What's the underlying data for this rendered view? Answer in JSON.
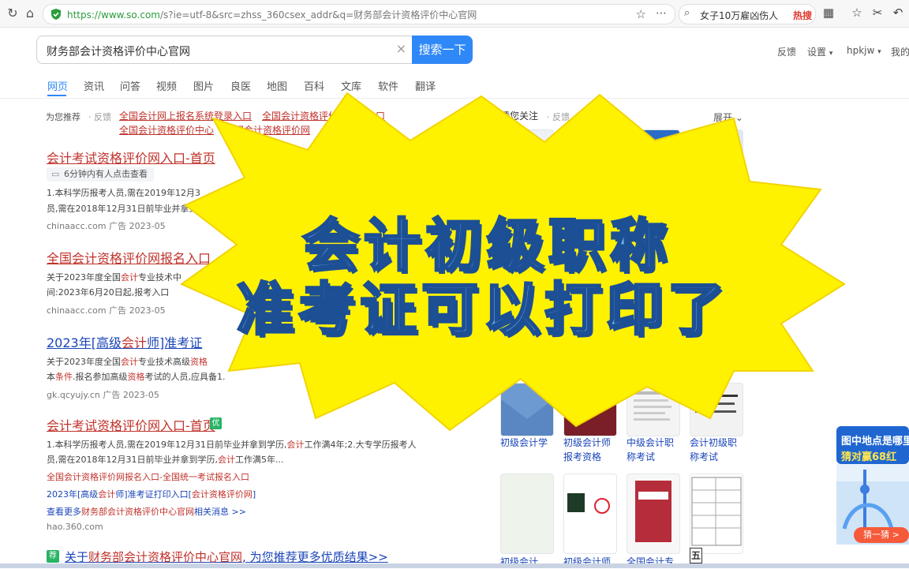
{
  "browser": {
    "url_domain": "https://www.so.com",
    "url_rest": "/s?ie=utf-8&src=zhss_360csex_addr&q=财务部会计资格评价中心官网",
    "hot_search": "女子10万雇凶伤人",
    "hot_badge": "热搜"
  },
  "search": {
    "query": "财务部会计资格评价中心官网",
    "button": "搜索一下"
  },
  "header_links": {
    "feedback": "反馈",
    "settings": "设置",
    "user": "hpkjw",
    "mine": "我的"
  },
  "tabs": [
    "网页",
    "资讯",
    "问答",
    "视频",
    "图片",
    "良医",
    "地图",
    "百科",
    "文库",
    "软件",
    "翻译"
  ],
  "recommend": {
    "label": "为您推荐",
    "feedback": "· 反馈",
    "links": [
      "全国会计网上报名系统登录入口",
      "全国会计资格评价网登录入口",
      "全国会计资格评价中心",
      "全国会计资格评价网"
    ]
  },
  "results": [
    {
      "title": "会计考试资格评价网入口-首页",
      "tag": "6分钟内有人点击查看",
      "line1": "1.本科学历报考人员,需在2019年12月3",
      "line2": "员,需在2018年12月31日前毕业并拿到学",
      "site": "chinaacc.com  广告  2023-05"
    },
    {
      "title": "全国会计资格评价网报名入口",
      "line1_a": "关于2023年度全国",
      "line1_b": "会计",
      "line1_c": "专业技术中",
      "line2": "间:2023年6月20日起,报考入口",
      "site": "chinaacc.com  广告  2023-05"
    },
    {
      "title_a": "2023年[高级",
      "title_b": "会计",
      "title_c": "师]准考证",
      "line1_a": "关于2023年度全国",
      "line1_b": "会计",
      "line1_c": "专业技术高级",
      "line1_d": "资格",
      "line2_a": "本",
      "line2_b": "条件",
      "line2_c": ".报名参加高级",
      "line2_d": "资格",
      "line2_e": "考试的人员,应具备1.",
      "site": "gk.qcyujy.cn  广告  2023-05"
    },
    {
      "title": "会计考试资格评价网入口-首页",
      "badge": "优",
      "line1_a": "1.本科学历报考人员,需在2019年12月31日前毕业并拿到学历,",
      "line1_b": "会计",
      "line1_c": "工作满4年;2.大专学历报考人",
      "line2_a": "员,需在2018年12月31日前毕业并拿到学历,",
      "line2_b": "会计",
      "line2_c": "工作满5年...",
      "sub1_a": "全国会计资格评价网报名入口-全国统一考试报名入口",
      "sub2_a": "2023年[高级",
      "sub2_b": "会计",
      "sub2_c": "师]准考证打印入口[",
      "sub2_d": "会计资格评价网",
      "sub2_e": "]",
      "more_a": "查看更多",
      "more_b": "财务部会计资格评价中心官网",
      "more_c": "相关消息 >>",
      "site": "hao.360.com"
    },
    {
      "badge": "荐",
      "title_a": "关于",
      "title_b": "财务部会计资格评价中心官网",
      "title_c": ", 为您推荐更多优质结果>>"
    }
  ],
  "right_col": {
    "title": "猜您关注",
    "feedback": "· 反馈",
    "expand": "展开",
    "items": [
      "初级会计学",
      "初级会计师报考资格",
      "中级会计职称考试",
      "会计初级职称考试",
      "初级会计",
      "初级会计师",
      "全国会计专",
      "五"
    ]
  },
  "overlay": {
    "line1": "会计初级职称",
    "line2": "准考证可以打印了"
  },
  "ad": {
    "headline": "图中地点是哪里",
    "prize": "猜对赢68红",
    "button": "猜一猜 >"
  },
  "colors": {
    "accent": "#2f88f7",
    "link_red": "#c0322b",
    "link_blue": "#1a44b8",
    "burst_yellow": "#fff200"
  }
}
